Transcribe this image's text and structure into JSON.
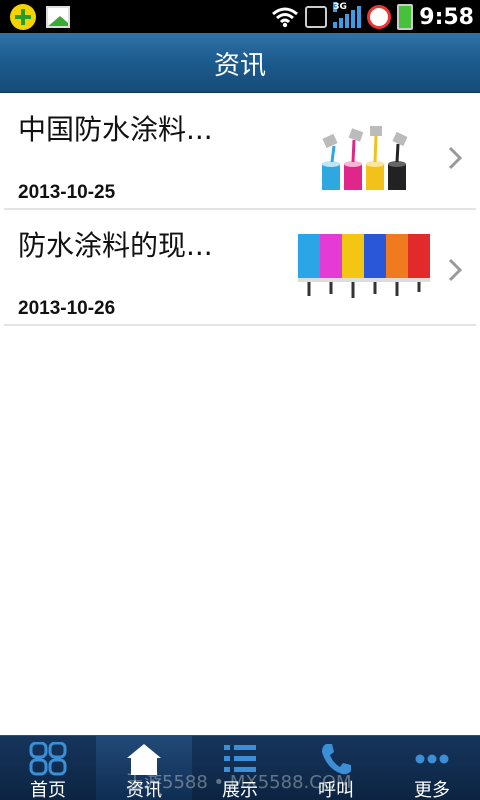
{
  "status_bar": {
    "time": "9:58",
    "network": "3G",
    "icons": [
      "app-plus-icon",
      "gallery-icon",
      "wifi-icon",
      "vibrate-icon",
      "signal-icon",
      "alarm-clock-icon",
      "battery-icon"
    ]
  },
  "header": {
    "title": "资讯"
  },
  "news": [
    {
      "title": "中国防水涂料...",
      "date": "2013-10-25",
      "thumbnail": "paint-cans-image"
    },
    {
      "title": "防水涂料的现...",
      "date": "2013-10-26",
      "thumbnail": "paint-rollers-image"
    }
  ],
  "tabs": [
    {
      "label": "首页",
      "icon": "home-grid-icon",
      "active": false
    },
    {
      "label": "资讯",
      "icon": "house-icon",
      "active": true
    },
    {
      "label": "展示",
      "icon": "list-icon",
      "active": false
    },
    {
      "label": "呼叫",
      "icon": "phone-icon",
      "active": false
    },
    {
      "label": "更多",
      "icon": "more-dots-icon",
      "active": false
    }
  ],
  "watermark": "玉游5588 • MX5588.COM",
  "colors": {
    "header": "#1c5a8d",
    "tab_bar": "#0c2442",
    "icon_blue": "#3c8fd6"
  }
}
